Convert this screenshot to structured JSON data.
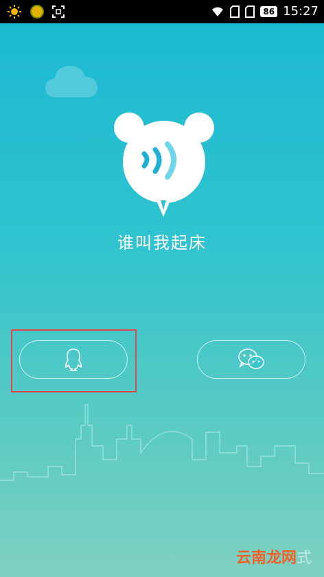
{
  "status_bar": {
    "battery": "86",
    "time": "15:27",
    "icons": [
      "sun-icon",
      "app-dot-icon",
      "scan-icon",
      "wifi-icon",
      "sim-icon",
      "sim-icon",
      "battery-icon"
    ]
  },
  "app": {
    "title": "谁叫我起床"
  },
  "login": {
    "qq_icon": "qq-penguin-icon",
    "wechat_icon": "wechat-icon"
  },
  "watermark": {
    "text": "云南龙网",
    "trailing": "式"
  },
  "colors": {
    "bg_top": "#1ab8d3",
    "bg_bottom": "#7fd0c2",
    "highlight": "#e04848",
    "logo_accent": "#1fb0d4"
  }
}
